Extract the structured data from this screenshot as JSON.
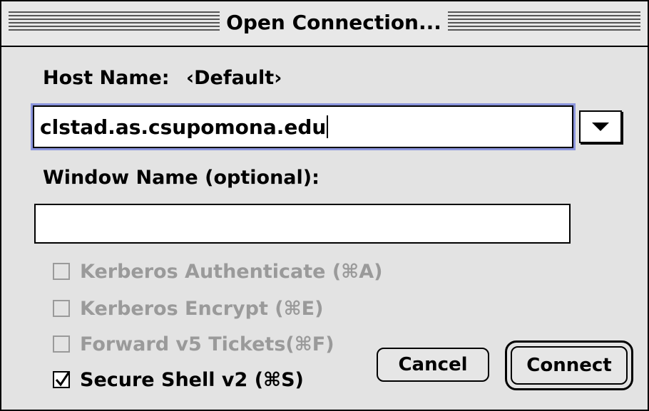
{
  "window": {
    "title": "Open Connection..."
  },
  "host": {
    "label": "Host Name:",
    "default_hint": "‹Default›",
    "value": "clstad.as.csupomona.edu"
  },
  "window_name": {
    "label": "Window Name (optional):",
    "value": ""
  },
  "options": [
    {
      "label": "Kerberos Authenticate (⌘A)",
      "checked": false,
      "enabled": false
    },
    {
      "label": "Kerberos Encrypt (⌘E)",
      "checked": false,
      "enabled": false
    },
    {
      "label": "Forward v5 Tickets(⌘F)",
      "checked": false,
      "enabled": false
    },
    {
      "label": "Secure Shell v2 (⌘S)",
      "checked": true,
      "enabled": true
    }
  ],
  "buttons": {
    "cancel": "Cancel",
    "connect": "Connect"
  }
}
